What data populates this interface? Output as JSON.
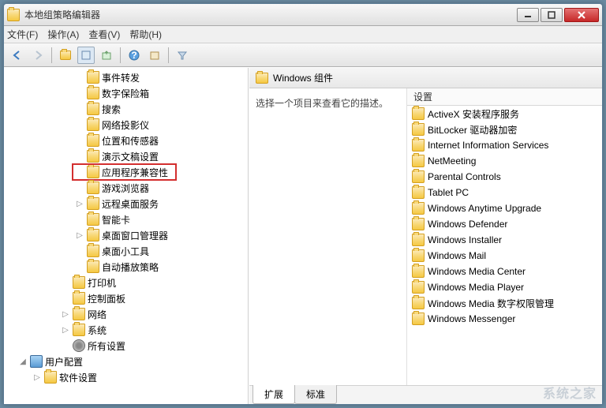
{
  "window": {
    "title": "本地组策略编辑器"
  },
  "menu": {
    "file": "文件(F)",
    "action": "操作(A)",
    "view": "查看(V)",
    "help": "帮助(H)"
  },
  "tree": {
    "items": [
      {
        "indent": 5,
        "expander": "",
        "icon": "folder",
        "label": "事件转发"
      },
      {
        "indent": 5,
        "expander": "",
        "icon": "folder",
        "label": "数字保险箱"
      },
      {
        "indent": 5,
        "expander": "",
        "icon": "folder",
        "label": "搜索"
      },
      {
        "indent": 5,
        "expander": "",
        "icon": "folder",
        "label": "网络投影仪"
      },
      {
        "indent": 5,
        "expander": "",
        "icon": "folder",
        "label": "位置和传感器"
      },
      {
        "indent": 5,
        "expander": "",
        "icon": "folder",
        "label": "演示文稿设置"
      },
      {
        "indent": 5,
        "expander": "",
        "icon": "folder",
        "label": "应用程序兼容性",
        "highlight": true
      },
      {
        "indent": 5,
        "expander": "",
        "icon": "folder",
        "label": "游戏浏览器"
      },
      {
        "indent": 5,
        "expander": "▷",
        "icon": "folder",
        "label": "远程桌面服务"
      },
      {
        "indent": 5,
        "expander": "",
        "icon": "folder",
        "label": "智能卡"
      },
      {
        "indent": 5,
        "expander": "▷",
        "icon": "folder",
        "label": "桌面窗口管理器"
      },
      {
        "indent": 5,
        "expander": "",
        "icon": "folder",
        "label": "桌面小工具"
      },
      {
        "indent": 5,
        "expander": "",
        "icon": "folder",
        "label": "自动播放策略"
      },
      {
        "indent": 4,
        "expander": "",
        "icon": "folder",
        "label": "打印机"
      },
      {
        "indent": 4,
        "expander": "",
        "icon": "folder",
        "label": "控制面板"
      },
      {
        "indent": 4,
        "expander": "▷",
        "icon": "folder",
        "label": "网络"
      },
      {
        "indent": 4,
        "expander": "▷",
        "icon": "folder",
        "label": "系统"
      },
      {
        "indent": 4,
        "expander": "",
        "icon": "settings",
        "label": "所有设置"
      },
      {
        "indent": 1,
        "expander": "◢",
        "icon": "computer",
        "label": "用户配置"
      },
      {
        "indent": 2,
        "expander": "▷",
        "icon": "folder",
        "label": "软件设置"
      }
    ]
  },
  "right": {
    "header": "Windows 组件",
    "description": "选择一个项目来查看它的描述。",
    "column_header": "设置",
    "items": [
      "ActiveX 安装程序服务",
      "BitLocker 驱动器加密",
      "Internet Information Services",
      "NetMeeting",
      "Parental Controls",
      "Tablet PC",
      "Windows Anytime Upgrade",
      "Windows Defender",
      "Windows Installer",
      "Windows Mail",
      "Windows Media Center",
      "Windows Media Player",
      "Windows Media 数字权限管理",
      "Windows Messenger"
    ]
  },
  "tabs": {
    "extended": "扩展",
    "standard": "标准"
  },
  "watermark": "系统之家"
}
